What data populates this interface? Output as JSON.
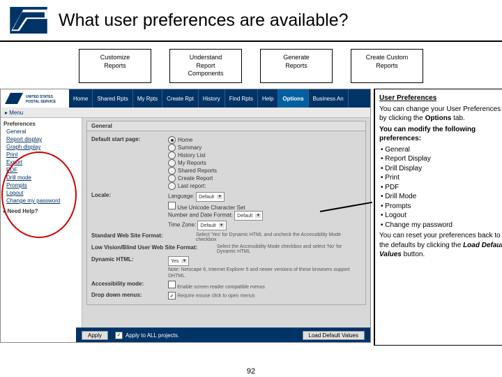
{
  "title": "What user preferences are available?",
  "nav_boxes": {
    "b1": "Customize\nReports",
    "b2": "Understand\nReport\nComponents",
    "b3": "Generate\nReports",
    "b4": "Create Custom\nReports"
  },
  "app": {
    "top_logo_text": "UNITED STATES\nPOSTAL SERVICE",
    "tabs": {
      "t0": "Home",
      "t1": "Shared Rpts",
      "t2": "My Rpts",
      "t3": "Create Rpt",
      "t4": "History",
      "t5": "Find Rpts",
      "t6": "Help",
      "t7": "Options",
      "t8": "Business An"
    },
    "menu_label": "▸ Menu",
    "sidebar": {
      "heading": "Preferences",
      "items": {
        "s0": "General",
        "s1": "Report display",
        "s2": "Graph display",
        "s3": "Print",
        "s4": "Export",
        "s5": "PDF",
        "s6": "Drill mode",
        "s7": "Prompts",
        "s8": "Logout",
        "s9": "Change my password"
      },
      "need_help": "Need Help?"
    },
    "panel": {
      "header": "General",
      "start_label": "Default start page:",
      "radios": {
        "r0": "Home",
        "r1": "Summary",
        "r2": "History List",
        "r3": "My Reports",
        "r4": "Shared Reports",
        "r5": "Create Report",
        "r6": "Last report:"
      },
      "locale_label": "Locale:",
      "lang_label": "Language:",
      "lang_value": "Default",
      "unicode_label": "Use Unicode Character Set",
      "numdate_label": "Number and Date Format:",
      "numdate_value": "Default",
      "tz_label": "Time Zone:",
      "tz_value": "Default",
      "std_label": "Standard Web Site Format:",
      "std_note": "Select 'Yes' for Dynamic HTML and uncheck the Accessibility Mode checkbox",
      "lowvis_label": "Low Vision/Blind User Web Site Format:",
      "lowvis_note": "Select the Accessibility Mode checkbox and select 'No' for Dynamic HTML",
      "dhtml_label": "Dynamic HTML:",
      "dhtml_value": "Yes",
      "dhtml_note": "Note: Netscape 6, Internet Explorer 5 and newer versions of these browsers support DHTML.",
      "acc_label": "Accessibility mode:",
      "acc_note": "Enable screen reader compatible menus",
      "dd_label": "Drop down menus:",
      "dd_note": "Require mouse click to open menus"
    },
    "bottom": {
      "apply": "Apply",
      "apply_all": "Apply to ALL projects.",
      "load_defaults": "Load Default Values"
    }
  },
  "explain": {
    "title": "User Preferences",
    "p1a": "You can change your User Preferences by clicking the ",
    "p1b": "Options",
    "p1c": " tab.",
    "p2": "You can modify the following preferences:",
    "bullets": {
      "e0": "General",
      "e1": "Report Display",
      "e2": "Drill Display",
      "e3": "Print",
      "e4": "PDF",
      "e5": "Drill Mode",
      "e6": "Prompts",
      "e7": "Logout",
      "e8": "Change my password"
    },
    "p3a": "You can reset your preferences back to the defaults by clicking the ",
    "p3b": "Load Default Values",
    "p3c": " button."
  },
  "page_number": "92"
}
